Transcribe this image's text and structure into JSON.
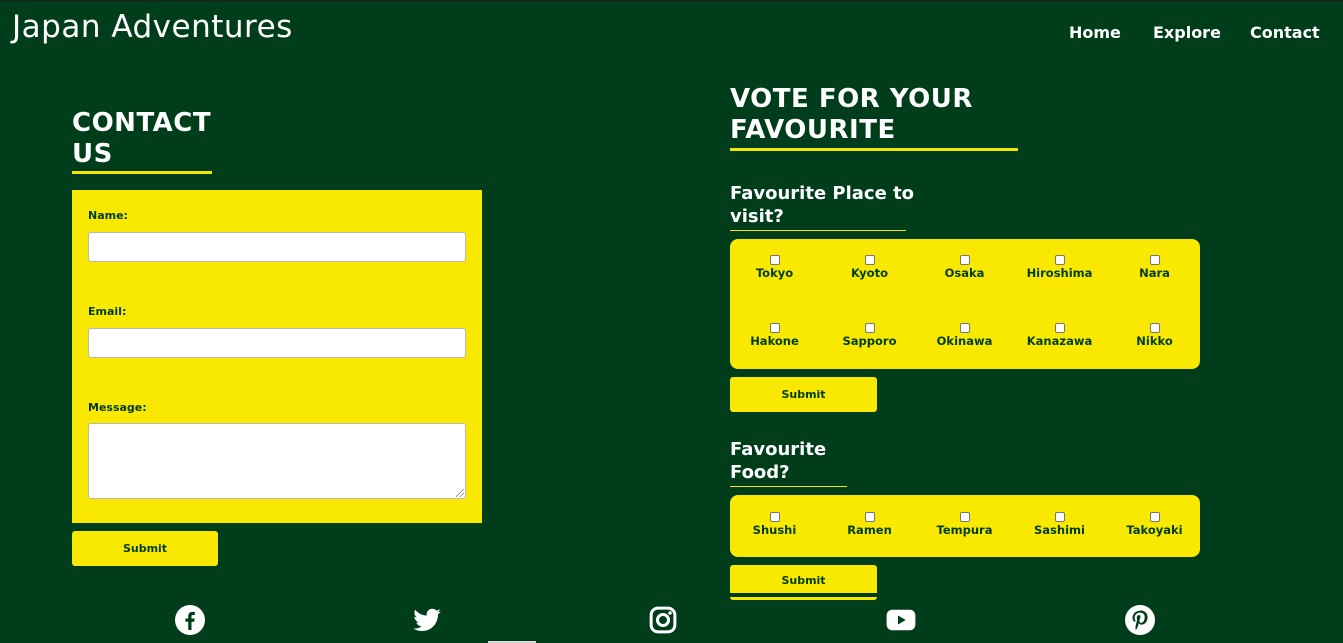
{
  "header": {
    "site_title": "Japan Adventures",
    "nav": [
      {
        "label": "Home"
      },
      {
        "label": "Explore"
      },
      {
        "label": "Contact"
      }
    ]
  },
  "contact": {
    "title_line1": "CONTACT",
    "title_line2": "US",
    "name_label": "Name:",
    "name_value": "",
    "email_label": "Email:",
    "email_value": "",
    "message_label": "Message:",
    "message_value": "",
    "submit_label": "Submit"
  },
  "vote": {
    "title_line1": "VOTE FOR YOUR",
    "title_line2": "FAVOURITE",
    "place": {
      "title_line1": "Favourite Place to",
      "title_line2": "visit?",
      "options": [
        "Tokyo",
        "Kyoto",
        "Osaka",
        "Hiroshima",
        "Nara",
        "Hakone",
        "Sapporo",
        "Okinawa",
        "Kanazawa",
        "Nikko"
      ],
      "submit_label": "Submit"
    },
    "food": {
      "title_line1": "Favourite",
      "title_line2": "Food?",
      "options": [
        "Shushi",
        "Ramen",
        "Tempura",
        "Sashimi",
        "Takoyaki"
      ],
      "submit_label": "Submit"
    }
  },
  "footer": {
    "social_icons": [
      "facebook-icon",
      "twitter-icon",
      "instagram-icon",
      "youtube-icon",
      "pinterest-icon"
    ]
  },
  "colors": {
    "background": "#003d1b",
    "accent": "#f9e900",
    "text": "#ffffff"
  }
}
